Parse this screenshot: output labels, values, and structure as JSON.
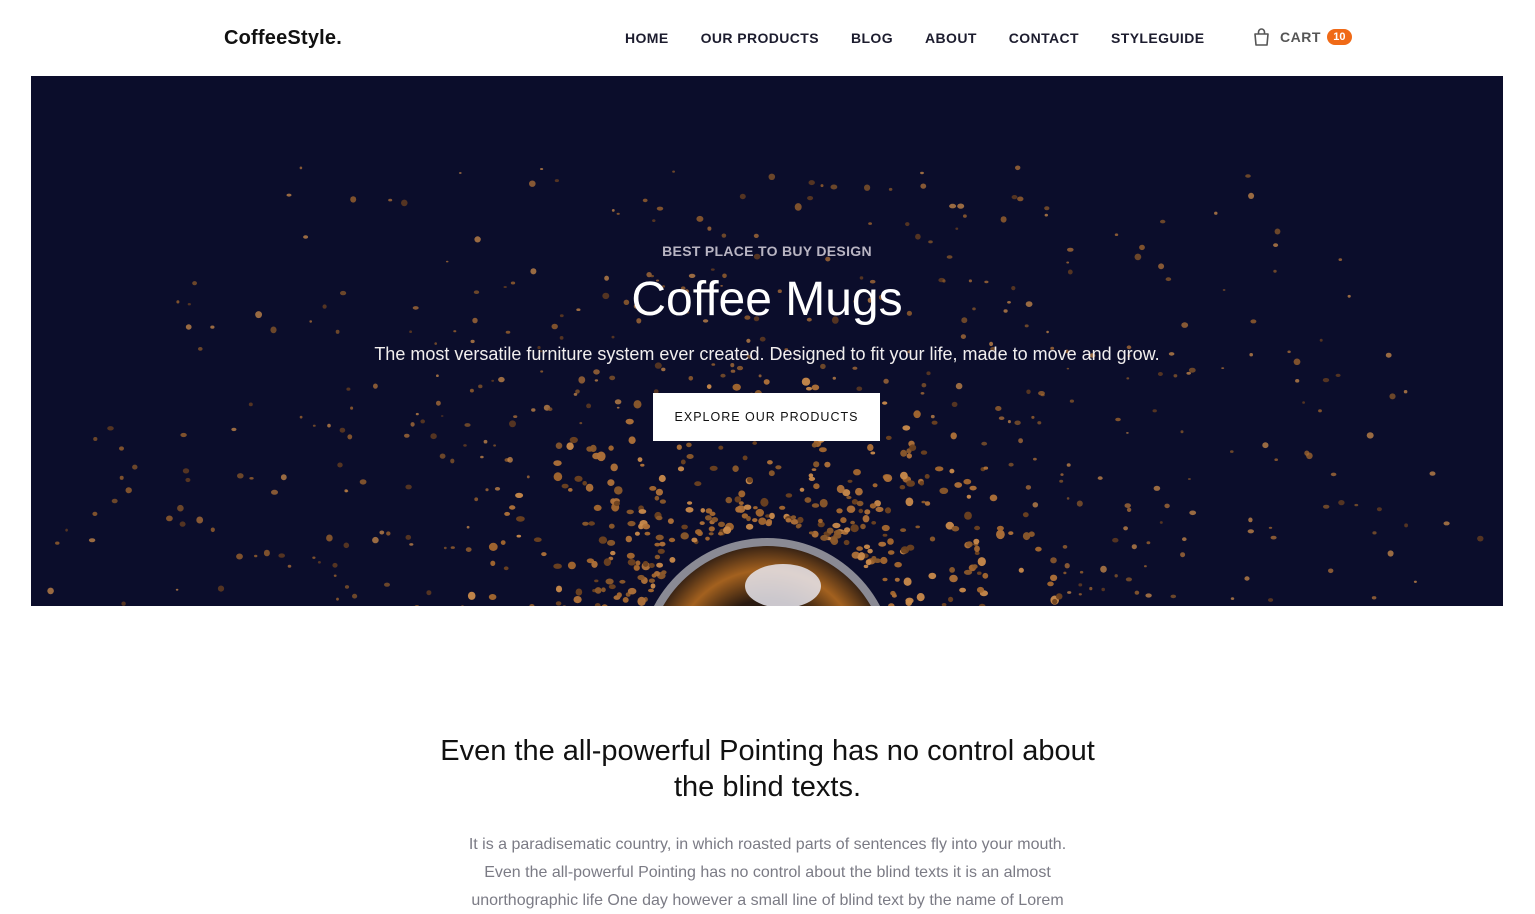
{
  "header": {
    "logo": "CoffeeStyle.",
    "nav": [
      "HOME",
      "OUR PRODUCTS",
      "BLOG",
      "ABOUT",
      "CONTACT",
      "STYLEGUIDE"
    ],
    "cart_label": "CART",
    "cart_count": "10",
    "cart_icon": "shopping-bag-icon"
  },
  "hero": {
    "eyebrow": "BEST PLACE TO BUY DESIGN",
    "title": "Coffee Mugs",
    "subtitle": "The most versatile furniture system ever created. Designed to fit your life, made to move and grow.",
    "cta_label": "EXPLORE OUR PRODUCTS",
    "background_color": "#0b0d2b"
  },
  "intro": {
    "title_lines": [
      "Even the all-powerful Pointing has no control about",
      "the blind texts."
    ],
    "text_lines": [
      "It is a paradisematic country, in which roasted parts of sentences fly into your mouth.",
      "Even the all-powerful Pointing has no control about the blind texts it is an almost",
      "unorthographic life One day however a small line of blind text by the name of Lorem"
    ]
  },
  "colors": {
    "accent": "#f06a17",
    "hero_bg": "#0b0d2b",
    "coffee": "#b07239"
  }
}
